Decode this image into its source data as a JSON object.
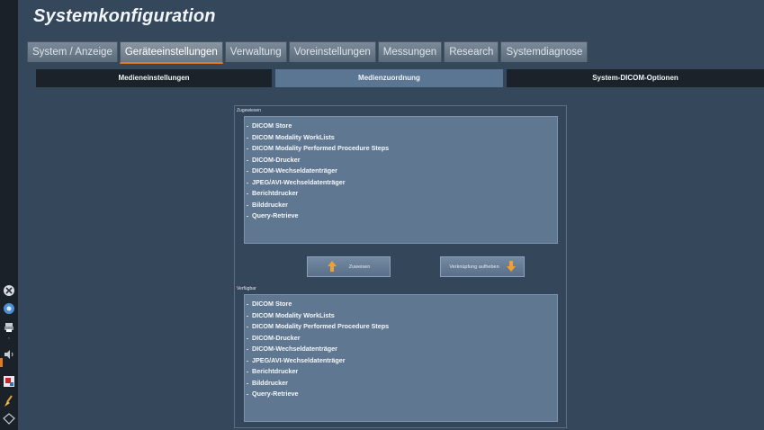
{
  "app": {
    "title": "Systemkonfiguration"
  },
  "tabs": [
    {
      "label": "System / Anzeige",
      "active": false
    },
    {
      "label": "Geräteeinstellungen",
      "active": true
    },
    {
      "label": "Verwaltung",
      "active": false
    },
    {
      "label": "Voreinstellungen",
      "active": false
    },
    {
      "label": "Messungen",
      "active": false
    },
    {
      "label": "Research",
      "active": false
    },
    {
      "label": "Systemdiagnose",
      "active": false
    }
  ],
  "subtabs": [
    {
      "label": "Medieneinstellungen",
      "selected": false
    },
    {
      "label": "Medienzuordnung",
      "selected": true
    },
    {
      "label": "System-DICOM-Optionen",
      "selected": false
    }
  ],
  "assigned": {
    "label": "Zugewiesen",
    "items": [
      "DICOM Store",
      "DICOM Modality WorkLists",
      "DICOM Modality Performed Procedure Steps",
      "DICOM-Drucker",
      "DICOM-Wechseldatenträger",
      "JPEG/AVI-Wechseldatenträger",
      "Berichtdrucker",
      "Bilddrucker",
      "Query-Retrieve"
    ]
  },
  "buttons": {
    "assign_label": "Zuweisen",
    "unlink_label": "Verknüpfung aufheben"
  },
  "available": {
    "label": "Verfügbar",
    "items": [
      "DICOM Store",
      "DICOM Modality WorkLists",
      "DICOM Modality Performed Procedure Steps",
      "DICOM-Drucker",
      "DICOM-Wechseldatenträger",
      "JPEG/AVI-Wechseldatenträger",
      "Berichtdrucker",
      "Bilddrucker",
      "Query-Retrieve"
    ]
  },
  "colors": {
    "accent": "#e07a20",
    "selected_subtab": "#5a7693",
    "list_bg": "#5f7790"
  },
  "icons": {
    "leftbar": [
      "close-circle-icon",
      "settings-circle-icon",
      "print-icon",
      "volume-icon",
      "patient-report-icon",
      "cleaning-brush-icon",
      "network-signal-icon"
    ]
  }
}
